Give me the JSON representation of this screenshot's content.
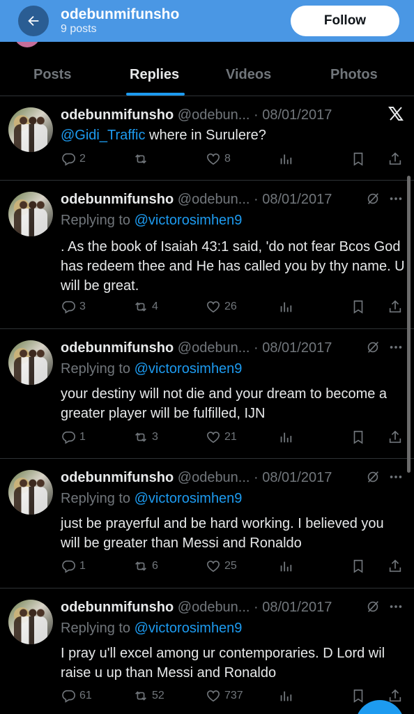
{
  "header": {
    "title": "odebunmifunsho",
    "subtitle": "9 posts",
    "follow_label": "Follow"
  },
  "tabs": [
    {
      "label": "Posts",
      "active": false
    },
    {
      "label": "Replies",
      "active": true
    },
    {
      "label": "Videos",
      "active": false
    },
    {
      "label": "Photos",
      "active": false
    }
  ],
  "tweets": [
    {
      "name": "odebunmifunsho",
      "handle": "@odebun... · 08/01/2017",
      "mention": "@Gidi_Traffic",
      "text": " where in Surulere?",
      "replies": "2",
      "retweets": "",
      "likes": "8"
    },
    {
      "name": "odebunmifunsho",
      "handle": "@odebun... · 08/01/2017",
      "replying_prefix": "Replying to ",
      "replying_to": "@victorosimhen9",
      "text": ". As the book of Isaiah 43:1 said, 'do not fear Bcos God has redeem thee and He has called you by thy name. U will be great.",
      "replies": "3",
      "retweets": "4",
      "likes": "26"
    },
    {
      "name": "odebunmifunsho",
      "handle": "@odebun... · 08/01/2017",
      "replying_prefix": "Replying to ",
      "replying_to": "@victorosimhen9",
      "text": "your destiny will not die and your dream to become a greater player will be fulfilled, IJN",
      "replies": "1",
      "retweets": "3",
      "likes": "21"
    },
    {
      "name": "odebunmifunsho",
      "handle": "@odebun... · 08/01/2017",
      "replying_prefix": "Replying to ",
      "replying_to": "@victorosimhen9",
      "text": "just be prayerful and be hard working. I believed you will be greater than Messi and Ronaldo",
      "replies": "1",
      "retweets": "6",
      "likes": "25"
    },
    {
      "name": "odebunmifunsho",
      "handle": "@odebun... · 08/01/2017",
      "replying_prefix": "Replying to ",
      "replying_to": "@victorosimhen9",
      "text": "I pray u'll excel among ur contemporaries. D Lord wil raise u up than Messi and Ronaldo",
      "replies": "61",
      "retweets": "52",
      "likes": "737"
    }
  ],
  "icons": {
    "back": "arrow-left-icon",
    "x_logo": "x-logo-icon",
    "grok": "grok-icon",
    "more": "more-icon",
    "reply": "reply-icon",
    "retweet": "retweet-icon",
    "like": "heart-icon",
    "views": "views-icon",
    "bookmark": "bookmark-icon",
    "share": "share-icon"
  },
  "colors": {
    "header_bg": "#4a97e4",
    "accent": "#1d9bf0",
    "background": "#000000",
    "muted": "#71767b"
  }
}
